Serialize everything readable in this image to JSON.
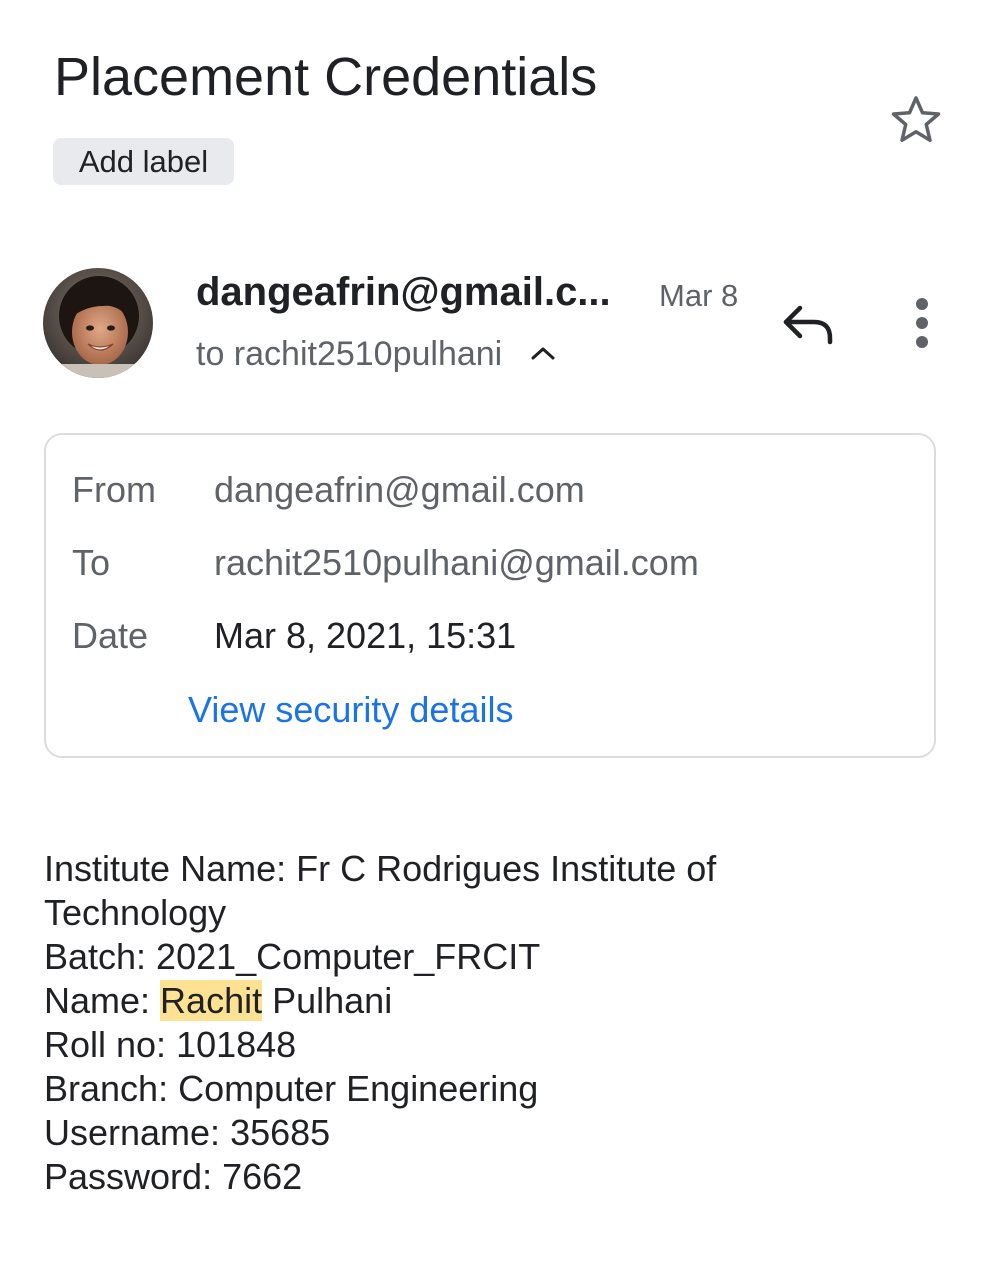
{
  "email": {
    "subject": "Placement Credentials",
    "add_label": "Add label",
    "sender_display": "dangeafrin@gmail.c...",
    "date_short": "Mar 8",
    "recipient_line": "to rachit2510pulhani"
  },
  "details": {
    "from_label": "From",
    "from_value": "dangeafrin@gmail.com",
    "to_label": "To",
    "to_value": "rachit2510pulhani@gmail.com",
    "date_label": "Date",
    "date_value": "Mar 8, 2021, 15:31",
    "security_link": "View security details"
  },
  "body": {
    "institute_line1": "Institute Name: Fr C Rodrigues Institute of",
    "institute_line2": "Technology",
    "batch": "Batch: 2021_Computer_FRCIT",
    "name_prefix": "Name: ",
    "name_highlight": "Rachit",
    "name_suffix": " Pulhani",
    "roll": "Roll no: 101848",
    "branch": "Branch: Computer Engineering",
    "username": "Username: 35685",
    "password": "Password: 7662"
  },
  "icons": {
    "star": "star-outline-icon",
    "chevron": "chevron-up-icon",
    "reply": "reply-icon",
    "more": "more-vert-icon",
    "avatar": "sender-avatar"
  },
  "colors": {
    "link": "#1a73e8",
    "highlight": "#fde293",
    "secondary_text": "#5f6368",
    "chip_background": "#e8eaed"
  }
}
